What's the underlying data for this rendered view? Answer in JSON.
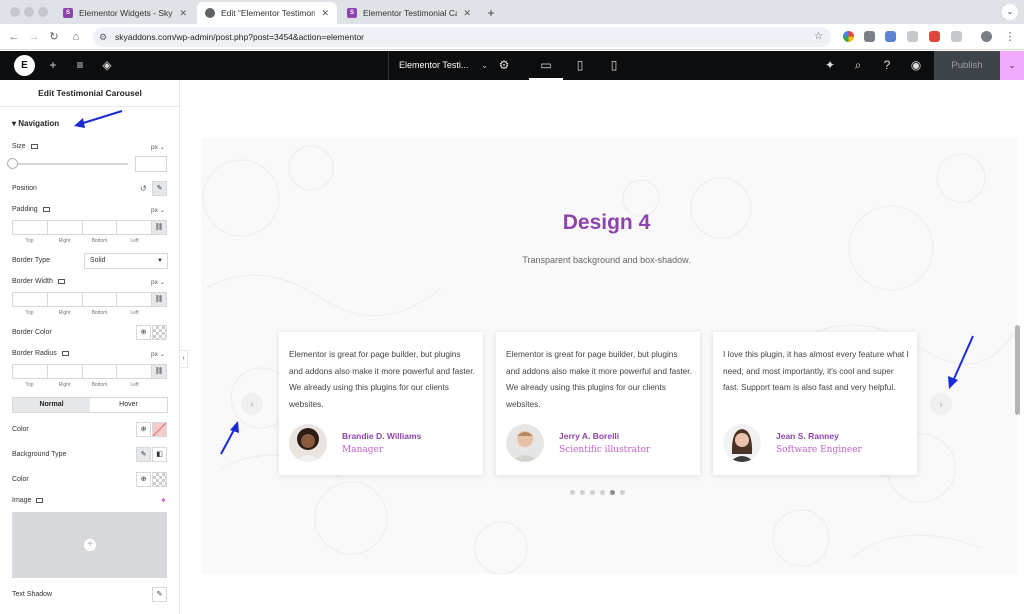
{
  "browser": {
    "tabs": [
      {
        "label": "Elementor Widgets - Sky Addons",
        "favicon_letter": "SA",
        "favicon_color": "#8e44ad"
      },
      {
        "label": "Edit “Elementor Testimonial Carousel”",
        "favicon_letter": "",
        "favicon_color": "#5f6368"
      },
      {
        "label": "Elementor Testimonial Carousel",
        "favicon_letter": "SA",
        "favicon_color": "#8e44ad"
      }
    ],
    "new_tab": "+",
    "url": "skyaddons.com/wp-admin/post.php?post=3454&action=elementor"
  },
  "editor_top": {
    "document_title": "Elementor Testi...",
    "publish_label": "Publish"
  },
  "panel": {
    "title": "Edit Testimonial Carousel",
    "section": "Navigation",
    "size_label": "Size",
    "size_unit": "px ⌄",
    "position_label": "Position",
    "padding_label": "Padding",
    "padding_unit": "px ⌄",
    "dim_labels": [
      "Top",
      "Right",
      "Bottom",
      "Left"
    ],
    "border_type_label": "Border Type",
    "border_type_value": "Solid",
    "border_width_label": "Border Width",
    "border_width_unit": "px ⌄",
    "border_color_label": "Border Color",
    "border_radius_label": "Border Radius",
    "border_radius_unit": "px ⌄",
    "tab_normal": "Normal",
    "tab_hover": "Hover",
    "color_label": "Color",
    "background_type_label": "Background Type",
    "color2_label": "Color",
    "image_label": "Image",
    "text_shadow_label": "Text Shadow"
  },
  "canvas": {
    "title": "Design 4",
    "subtitle": "Transparent background and box-shadow.",
    "testimonials": [
      {
        "quote": "Elementor is great for page builder, but plugins and addons also make it more powerful and faster. We already using this plugins for our clients websites.",
        "name": "Brandie D. Williams",
        "role": "Manager"
      },
      {
        "quote": "Elementor is great for page builder, but plugins and addons also make it more powerful and faster. We already using this plugins for our clients websites.",
        "name": "Jerry A. Borelli",
        "role": "Scientific illustrator"
      },
      {
        "quote": "I love this plugin, it has almost every feature what I need, and most importantly, it's cool and super fast. Support team is also fast and very helpful.",
        "name": "Jean S. Ranney",
        "role": "Software Engineer"
      }
    ],
    "pagination_total": 6,
    "pagination_active": 5,
    "prev_arrow": "‹",
    "next_arrow": "›"
  },
  "colors": {
    "accent": "#8e44ad",
    "role": "#c061cb",
    "annotation_arrow": "#1a2bd6",
    "publish_more": "#f0abfc"
  }
}
